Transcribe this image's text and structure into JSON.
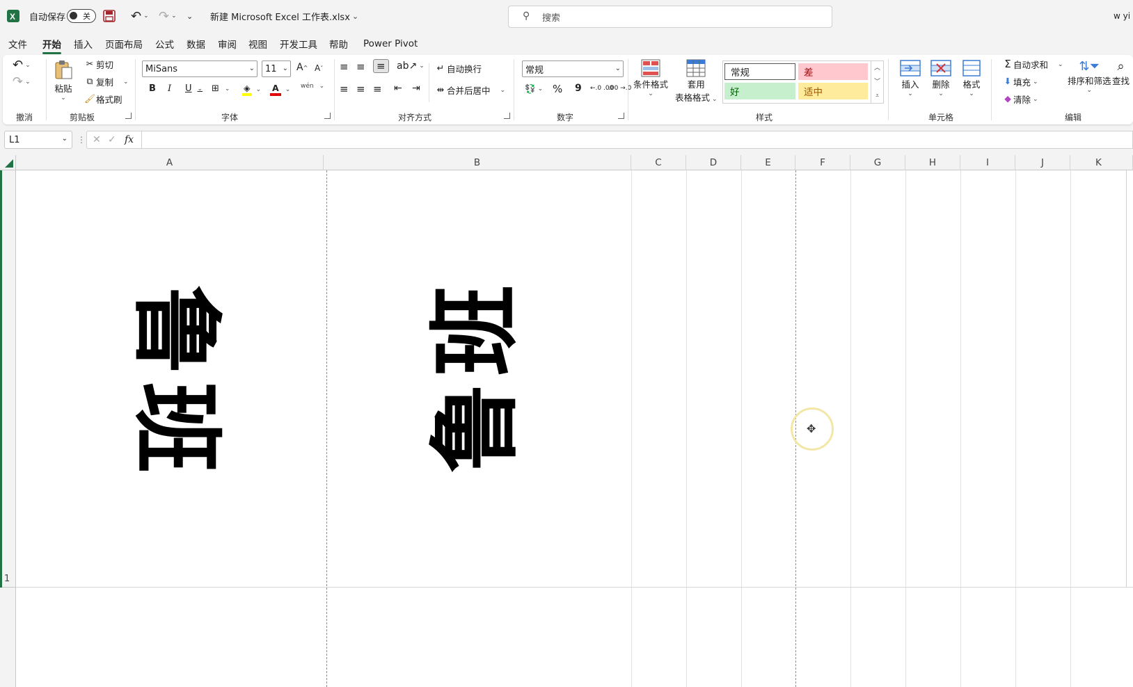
{
  "titlebar": {
    "autosave_label": "自动保存",
    "autosave_state": "关",
    "filename": "新建 Microsoft Excel 工作表.xlsx",
    "search_placeholder": "搜索",
    "user": "w yi"
  },
  "menu": [
    "文件",
    "开始",
    "插入",
    "页面布局",
    "公式",
    "数据",
    "审阅",
    "视图",
    "开发工具",
    "帮助",
    "Power Pivot"
  ],
  "menu_active": "开始",
  "ribbon": {
    "undo_group": "撤消",
    "clipboard": {
      "paste": "粘贴",
      "cut": "剪切",
      "copy": "复制",
      "format_painter": "格式刷",
      "group": "剪贴板"
    },
    "font": {
      "name": "MiSans",
      "size": "11",
      "bold": "B",
      "italic": "I",
      "underline": "U",
      "phonetic": "wén",
      "group": "字体"
    },
    "alignment": {
      "wrap_text": "自动换行",
      "merge_center": "合并后居中",
      "group": "对齐方式"
    },
    "number": {
      "format": "常规",
      "percent": "%",
      "comma": "9",
      "inc_decimal": "←.0 .00",
      "dec_decimal": ".00 →.0",
      "group": "数字"
    },
    "styles": {
      "conditional": "条件格式",
      "table_format_1": "套用",
      "table_format_2": "表格格式",
      "normal": "常规",
      "bad": "差",
      "good": "好",
      "neutral": "适中",
      "group": "样式"
    },
    "cells": {
      "insert": "插入",
      "delete": "删除",
      "format": "格式",
      "group": "单元格"
    },
    "editing": {
      "autosum": "自动求和",
      "fill": "填充",
      "clear": "清除",
      "sort_filter": "排序和筛选",
      "find": "查找",
      "group": "编辑"
    }
  },
  "formula_bar": {
    "name_box": "L1",
    "fx": "fx",
    "content": ""
  },
  "columns": [
    "A",
    "B",
    "C",
    "D",
    "E",
    "F",
    "G",
    "H",
    "I",
    "J",
    "K"
  ],
  "rows": [
    "1"
  ],
  "cells": {
    "A1": [
      "鲁",
      "班"
    ],
    "B1": [
      "班",
      "鲁"
    ]
  },
  "colors": {
    "accent": "#217346",
    "bad_bg": "#ffc7ce",
    "bad_fg": "#9c0006",
    "good_bg": "#c6efce",
    "good_fg": "#006100",
    "neutral_bg": "#ffeb9c",
    "neutral_fg": "#9c5700"
  }
}
